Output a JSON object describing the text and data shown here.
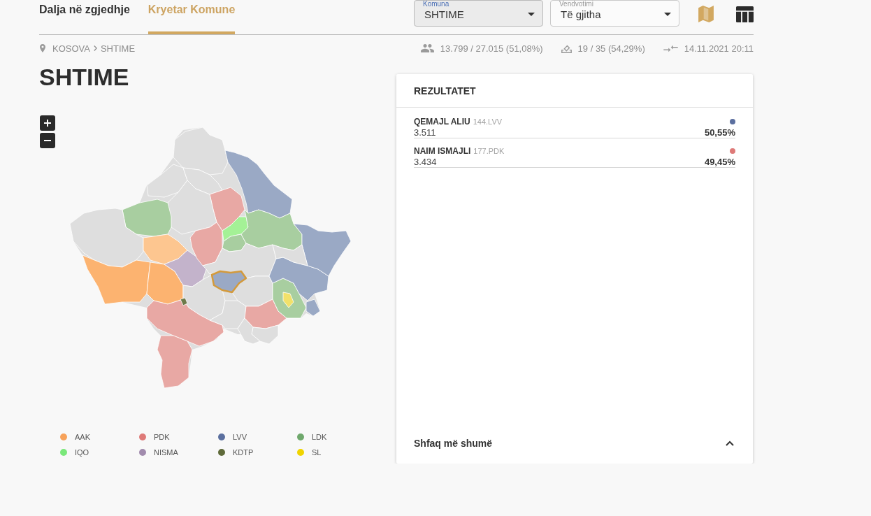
{
  "tabs": [
    {
      "label": "Dalja në zgjedhje",
      "selected": false
    },
    {
      "label": "Kryetar Komune",
      "selected": true
    }
  ],
  "filters": [
    {
      "label": "Komuna",
      "value": "SHTIME",
      "active": true
    },
    {
      "label": "Vendvotimi",
      "value": "Të gjitha",
      "active": false
    }
  ],
  "views": [
    {
      "kind": "map",
      "selected": true
    },
    {
      "kind": "table",
      "selected": false
    }
  ],
  "breadcrumb": [
    "KOSOVA",
    "SHTIME"
  ],
  "stats": [
    {
      "kind": "voters",
      "text": "13.799 / 27.015 (51,08%)"
    },
    {
      "kind": "stations",
      "text": "19 / 35 (54,29%)"
    },
    {
      "kind": "updated",
      "text": "14.11.2021 20:11"
    }
  ],
  "title": "SHTIME",
  "map": {
    "regions": [
      {
        "color": "#dedede",
        "selected": false
      },
      {
        "color": "#dedede",
        "selected": false
      },
      {
        "color": "#dedede",
        "selected": false
      },
      {
        "color": "#9aa9c5",
        "selected": false
      },
      {
        "color": "#e8a8a4",
        "selected": false
      },
      {
        "color": "#dedede",
        "selected": false
      },
      {
        "color": "#a8cea0",
        "selected": false
      },
      {
        "color": "#dedede",
        "selected": false
      },
      {
        "color": "#fdc690",
        "selected": false
      },
      {
        "color": "#fcb370",
        "selected": false
      },
      {
        "color": "#fcb370",
        "selected": false
      },
      {
        "color": "#c3b3cb",
        "selected": false
      },
      {
        "color": "#e8a8a4",
        "selected": false
      },
      {
        "color": "#a4f196",
        "selected": false
      },
      {
        "color": "#a8cea0",
        "selected": false
      },
      {
        "color": "#a8cea0",
        "selected": false
      },
      {
        "color": "#dedede",
        "selected": false
      },
      {
        "color": "#9aa9c5",
        "selected": true
      },
      {
        "color": "#dedede",
        "selected": false
      },
      {
        "color": "#e8a8a4",
        "selected": false
      },
      {
        "color": "#e8a8a4",
        "selected": false
      },
      {
        "color": "#dedede",
        "selected": false
      },
      {
        "color": "#dedede",
        "selected": false
      },
      {
        "color": "#e8a8a4",
        "selected": false
      },
      {
        "color": "#dedede",
        "selected": false
      },
      {
        "color": "#a8cea0",
        "selected": false
      },
      {
        "color": "#f1e16a",
        "selected": false
      },
      {
        "color": "#9aa9c5",
        "selected": false
      },
      {
        "color": "#9aa9c5",
        "selected": false
      },
      {
        "color": "#9aa9c5",
        "selected": false
      },
      {
        "color": "#dedede",
        "selected": false
      },
      {
        "color": "#6d7a4a",
        "selected": false
      },
      {
        "color": "#dedede",
        "selected": false
      }
    ]
  },
  "legend": [
    {
      "label": "AAK",
      "color": "#f7a25a"
    },
    {
      "label": "PDK",
      "color": "#de7a78"
    },
    {
      "label": "LVV",
      "color": "#5b6f9f"
    },
    {
      "label": "LDK",
      "color": "#6fa86c"
    },
    {
      "label": "IQO",
      "color": "#7ae87a"
    },
    {
      "label": "NISMA",
      "color": "#a18bad"
    },
    {
      "label": "KDTP",
      "color": "#5f6a3a"
    },
    {
      "label": "SL",
      "color": "#f0d400"
    }
  ],
  "results": {
    "title": "REZULTATET",
    "candidates": [
      {
        "name": "QEMAJL ALIU",
        "code": "144.LVV",
        "votes": "3.511",
        "percent": "50,55%",
        "color": "#5b6f9f"
      },
      {
        "name": "NAIM ISMAJLI",
        "code": "177.PDK",
        "votes": "3.434",
        "percent": "49,45%",
        "color": "#de7a78"
      }
    ],
    "footer": "Shfaq më shumë"
  }
}
